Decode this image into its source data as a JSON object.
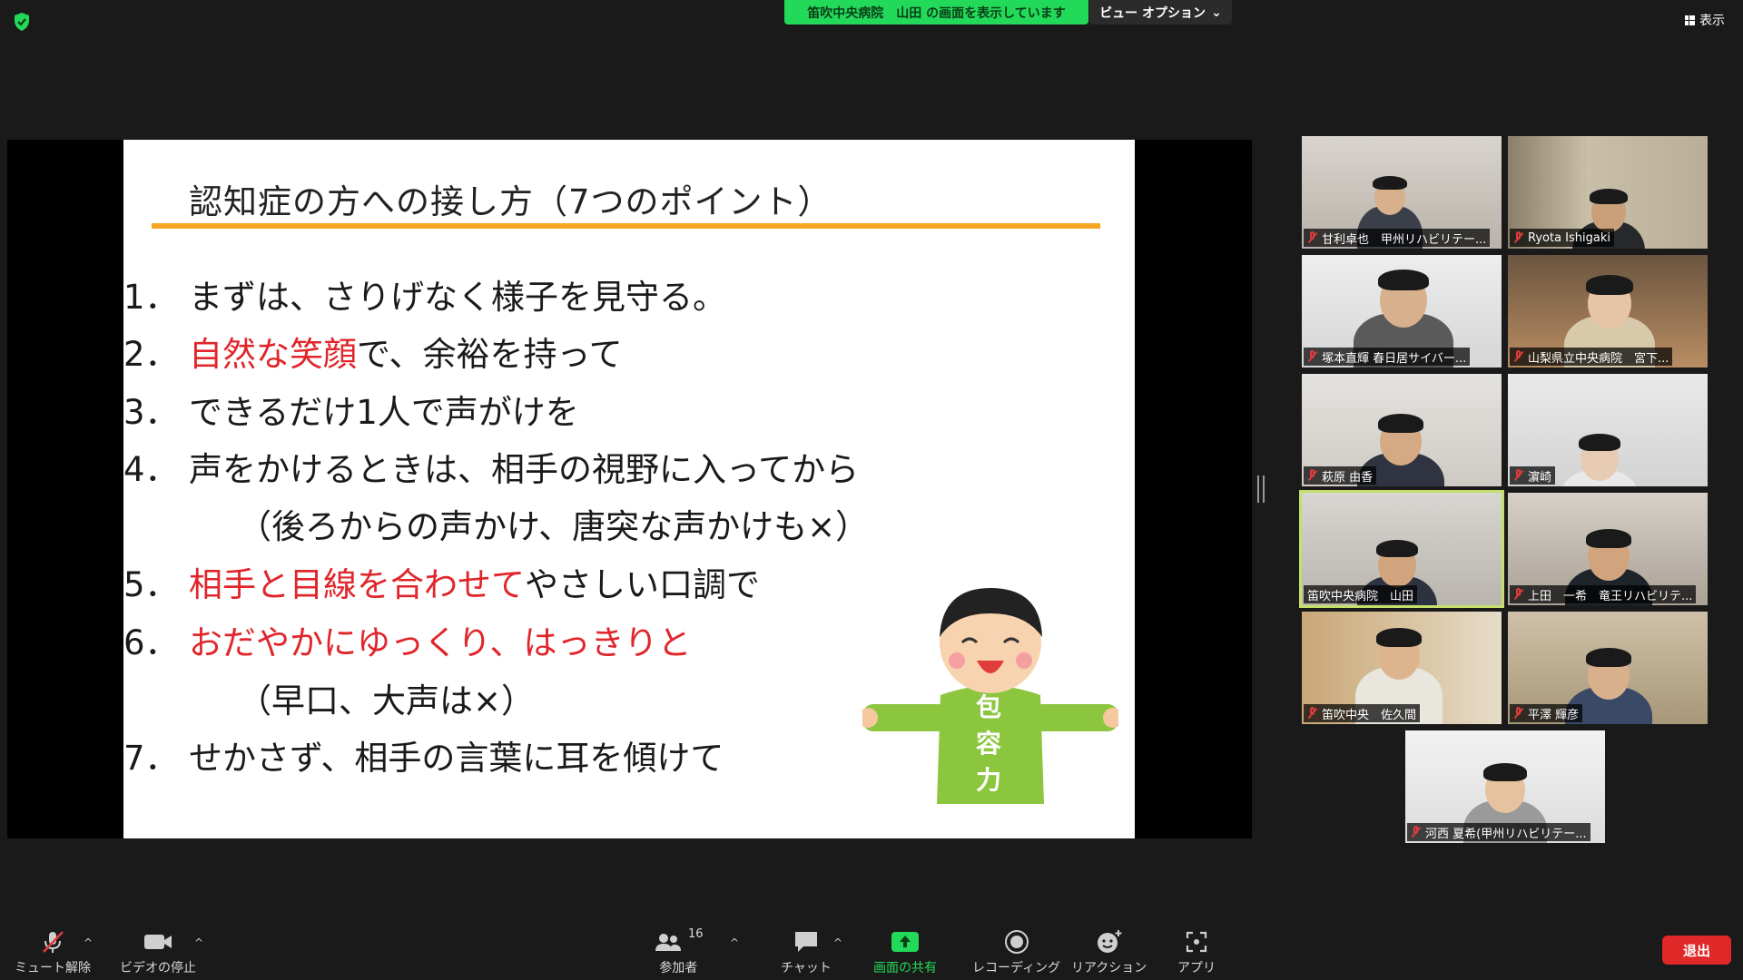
{
  "top": {
    "share_banner": "笛吹中央病院　山田 の画面を表示しています",
    "view_options": "ビュー オプション",
    "view_toggle": "表示"
  },
  "slide": {
    "title": "認知症の方への接し方（7つのポイント）",
    "points": [
      {
        "num": "1．",
        "parts": [
          {
            "text": "まずは、さりげなく様子を見守る。",
            "red": false
          }
        ]
      },
      {
        "num": "2．",
        "parts": [
          {
            "text": "自然な笑顔",
            "red": true
          },
          {
            "text": "で、余裕を持って",
            "red": false
          }
        ]
      },
      {
        "num": "3．",
        "parts": [
          {
            "text": "できるだけ1人で声がけを",
            "red": false
          }
        ]
      },
      {
        "num": "4．",
        "parts": [
          {
            "text": "声をかけるときは、相手の視野に入ってから",
            "red": false
          }
        ]
      },
      {
        "num": "5．",
        "parts": [
          {
            "text": "相手と目線を合わせて",
            "red": true
          },
          {
            "text": "やさしい口調で",
            "red": false
          }
        ]
      },
      {
        "num": "6．",
        "parts": [
          {
            "text": "おだやかにゆっくり、はっきりと",
            "red": true
          }
        ]
      },
      {
        "num": "7．",
        "parts": [
          {
            "text": "せかさず、相手の言葉に耳を傾けて",
            "red": false
          }
        ]
      }
    ],
    "sub4": "（後ろからの声かけ、唐突な声かけも×）",
    "sub6": "（早口、大声は×）",
    "mascot_text": "包容力"
  },
  "participants": [
    {
      "name": "甘利卓也　甲州リハビリテー...",
      "muted": true,
      "active": false
    },
    {
      "name": "Ryota Ishigaki",
      "muted": true,
      "active": false
    },
    {
      "name": "塚本直輝 春日居サイバー...",
      "muted": true,
      "active": false
    },
    {
      "name": "山梨県立中央病院　宮下...",
      "muted": true,
      "active": false
    },
    {
      "name": "萩原 由香",
      "muted": true,
      "active": false
    },
    {
      "name": "濵崎",
      "muted": true,
      "active": false
    },
    {
      "name": "笛吹中央病院　山田",
      "muted": false,
      "active": true
    },
    {
      "name": "上田　一希　竜王リハビリテ...",
      "muted": true,
      "active": false
    },
    {
      "name": "笛吹中央　佐久間",
      "muted": true,
      "active": false
    },
    {
      "name": "平澤 輝彦",
      "muted": true,
      "active": false
    },
    {
      "name": "河西 夏希(甲州リハビリテー...",
      "muted": true,
      "active": false
    }
  ],
  "toolbar": {
    "unmute": "ミュート解除",
    "stop_video": "ビデオの停止",
    "participants": "参加者",
    "participants_count": "16",
    "chat": "チャット",
    "share_screen": "画面の共有",
    "recording": "レコーディング",
    "reactions": "リアクション",
    "apps": "アプリ",
    "leave": "退出"
  },
  "colors": {
    "share_green": "#23d959",
    "accent_orange": "#f5a623",
    "slide_red": "#e0252b",
    "active_speaker": "#c5e06a",
    "leave_red": "#e02828"
  }
}
